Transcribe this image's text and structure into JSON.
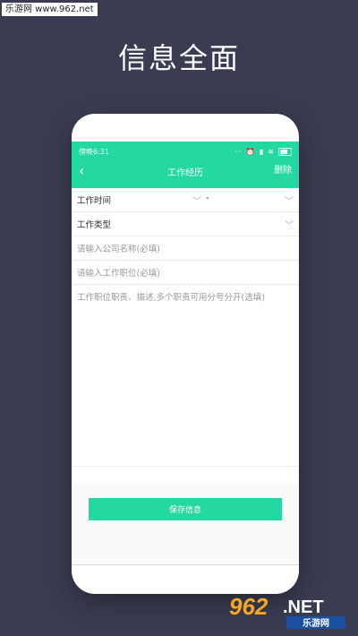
{
  "watermark": {
    "text": "乐游网 www.962.net"
  },
  "headline": "信息全面",
  "status_bar": {
    "time": "傍晚6:31"
  },
  "app_bar": {
    "back_icon": "chevron-left-icon",
    "title": "工作经历",
    "action": "删除"
  },
  "form": {
    "work_time_label": "工作时间",
    "work_time_separator": "-",
    "work_type_label": "工作类型",
    "company_placeholder": "请输入公司名称(必填)",
    "position_placeholder": "请输入工作职位(必填)",
    "description_placeholder": "工作职位职责、描述,多个职责可用分号分开(选填)"
  },
  "save_button": "保存信息",
  "logo": {
    "number": "962",
    "suffix": ".NET",
    "tagline": "乐游网"
  },
  "colors": {
    "accent": "#23d8a1",
    "background": "#3a3d52"
  }
}
